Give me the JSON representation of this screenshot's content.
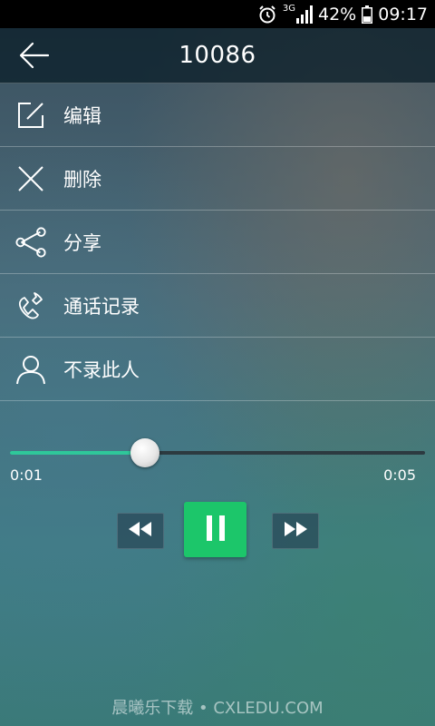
{
  "status_bar": {
    "network": "3G",
    "battery_percent": "42%",
    "battery_level": 0.42,
    "time": "09:17"
  },
  "header": {
    "title": "10086"
  },
  "menu": [
    {
      "label": "编辑",
      "icon": "edit-icon"
    },
    {
      "label": "删除",
      "icon": "close-icon"
    },
    {
      "label": "分享",
      "icon": "share-icon"
    },
    {
      "label": "通话记录",
      "icon": "phone-icon"
    },
    {
      "label": "不录此人",
      "icon": "person-icon"
    }
  ],
  "player": {
    "current_time": "0:01",
    "total_time": "0:05",
    "progress": 0.325,
    "accent_color": "#2fc79a",
    "pause_color": "#1cc66a"
  },
  "watermark": "晨曦乐下载 • CXLEDU.COM"
}
